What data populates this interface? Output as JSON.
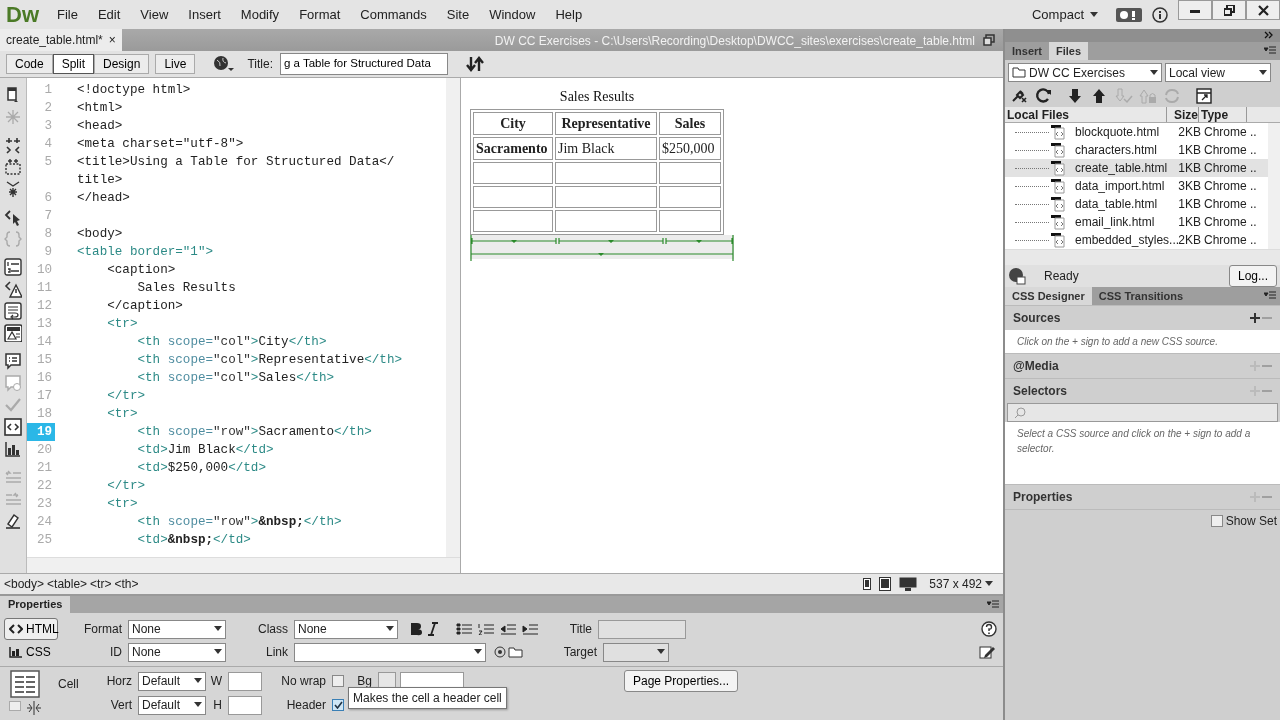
{
  "menu_bar": {
    "logo": "Dw",
    "items": [
      "File",
      "Edit",
      "View",
      "Insert",
      "Modify",
      "Format",
      "Commands",
      "Site",
      "Window",
      "Help"
    ],
    "workspace": "Compact"
  },
  "document_tab": {
    "label": "create_table.html*",
    "close": "×",
    "path": "DW CC Exercises - C:\\Users\\Recording\\Desktop\\DWCC_sites\\exercises\\create_table.html"
  },
  "view_buttons": [
    {
      "label": "Code",
      "selected": false
    },
    {
      "label": "Split",
      "selected": true
    },
    {
      "label": "Design",
      "selected": false
    },
    {
      "label": "Live",
      "selected": false
    }
  ],
  "title_field": {
    "label": "Title:",
    "value": "g a Table for Structured Data"
  },
  "code_lines": [
    {
      "number": "1",
      "current": false,
      "parts": [
        {
          "kind": "text",
          "t": "<!doctype html>"
        }
      ]
    },
    {
      "number": "2",
      "current": false,
      "parts": [
        {
          "kind": "text",
          "t": "<html>"
        }
      ]
    },
    {
      "number": "3",
      "current": false,
      "parts": [
        {
          "kind": "text",
          "t": "<head>"
        }
      ]
    },
    {
      "number": "4",
      "current": false,
      "parts": [
        {
          "kind": "text",
          "t": "<meta charset=\"utf-8\">"
        }
      ]
    },
    {
      "number": "5",
      "current": false,
      "parts": [
        {
          "kind": "text",
          "t": "<title>Using a Table for Structured Data</"
        }
      ]
    },
    {
      "parts": [
        {
          "kind": "text",
          "t": "title>"
        }
      ]
    },
    {
      "number": "6",
      "current": false,
      "parts": [
        {
          "kind": "text",
          "t": "</head>"
        }
      ]
    },
    {
      "number": "7",
      "current": false
    },
    {
      "number": "8",
      "current": false,
      "parts": [
        {
          "kind": "text",
          "t": "<body>"
        }
      ]
    },
    {
      "number": "9",
      "current": false,
      "parts": [
        {
          "kind": "tag",
          "t": "<table border=\"1\">"
        }
      ]
    },
    {
      "number": "10",
      "current": false,
      "parts": [
        {
          "kind": "text",
          "t": "    <caption>"
        }
      ]
    },
    {
      "number": "11",
      "current": false,
      "parts": [
        {
          "kind": "text",
          "t": "        Sales Results"
        }
      ]
    },
    {
      "number": "12",
      "current": false,
      "parts": [
        {
          "kind": "text",
          "t": "    </caption>"
        }
      ]
    },
    {
      "number": "13",
      "current": false,
      "parts": [
        {
          "kind": "tag",
          "t": "    <tr>"
        }
      ]
    },
    {
      "number": "14",
      "current": false,
      "parts": [
        {
          "kind": "tag",
          "t": "        <th "
        },
        {
          "kind": "attr",
          "t": "scope="
        },
        {
          "kind": "value",
          "t": "\"col\""
        },
        {
          "kind": "tag",
          "t": ">"
        },
        {
          "kind": "text",
          "t": "City"
        },
        {
          "kind": "tag",
          "t": "</th>"
        }
      ]
    },
    {
      "number": "15",
      "current": false,
      "parts": [
        {
          "kind": "tag",
          "t": "        <th "
        },
        {
          "kind": "attr",
          "t": "scope="
        },
        {
          "kind": "value",
          "t": "\"col\""
        },
        {
          "kind": "tag",
          "t": ">"
        },
        {
          "kind": "text",
          "t": "Representative"
        },
        {
          "kind": "tag",
          "t": "</th>"
        }
      ]
    },
    {
      "number": "16",
      "current": false,
      "parts": [
        {
          "kind": "tag",
          "t": "        <th "
        },
        {
          "kind": "attr",
          "t": "scope="
        },
        {
          "kind": "value",
          "t": "\"col\""
        },
        {
          "kind": "tag",
          "t": ">"
        },
        {
          "kind": "text",
          "t": "Sales"
        },
        {
          "kind": "tag",
          "t": "</th>"
        }
      ]
    },
    {
      "number": "17",
      "current": false,
      "parts": [
        {
          "kind": "tag",
          "t": "    </tr>"
        }
      ]
    },
    {
      "number": "18",
      "current": false,
      "parts": [
        {
          "kind": "tag",
          "t": "    <tr>"
        }
      ]
    },
    {
      "number": "19",
      "current": true,
      "parts": [
        {
          "kind": "tag",
          "t": "        <th "
        },
        {
          "kind": "attr",
          "t": "scope="
        },
        {
          "kind": "value",
          "t": "\"row\""
        },
        {
          "kind": "tag",
          "t": ">"
        },
        {
          "kind": "text",
          "t": "Sacramento"
        },
        {
          "kind": "tag",
          "t": "</th>"
        }
      ]
    },
    {
      "number": "20",
      "current": false,
      "parts": [
        {
          "kind": "tag",
          "t": "        <td>"
        },
        {
          "kind": "text",
          "t": "Jim Black"
        },
        {
          "kind": "tag",
          "t": "</td>"
        }
      ]
    },
    {
      "number": "21",
      "current": false,
      "parts": [
        {
          "kind": "tag",
          "t": "        <td>"
        },
        {
          "kind": "text",
          "t": "$250,000"
        },
        {
          "kind": "tag",
          "t": "</td>"
        }
      ]
    },
    {
      "number": "22",
      "current": false,
      "parts": [
        {
          "kind": "tag",
          "t": "    </tr>"
        }
      ]
    },
    {
      "number": "23",
      "current": false,
      "parts": [
        {
          "kind": "tag",
          "t": "    <tr>"
        }
      ]
    },
    {
      "number": "24",
      "current": false,
      "parts": [
        {
          "kind": "tag",
          "t": "        <th "
        },
        {
          "kind": "attr",
          "t": "scope="
        },
        {
          "kind": "value",
          "t": "\"row\""
        },
        {
          "kind": "tag",
          "t": ">"
        },
        {
          "kind": "entity",
          "t": "&nbsp;"
        },
        {
          "kind": "tag",
          "t": "</th>"
        }
      ]
    },
    {
      "number": "25",
      "current": false,
      "parts": [
        {
          "kind": "tag",
          "t": "        <td>"
        },
        {
          "kind": "entity",
          "t": "&nbsp;"
        },
        {
          "kind": "tag",
          "t": "</td>"
        }
      ]
    }
  ],
  "design_table": {
    "caption": "Sales Results",
    "columns": [
      "City",
      "Representative",
      "Sales"
    ],
    "rows": [
      {
        "kind": "data",
        "cells": [
          {
            "text": "Sacramento",
            "header": true
          },
          {
            "text": "Jim Black",
            "header": false
          },
          {
            "text": "$250,000",
            "header": false
          }
        ]
      },
      {
        "kind": "blank"
      },
      {
        "kind": "blank"
      },
      {
        "kind": "blank"
      }
    ]
  },
  "tag_selector": [
    "<body>",
    "<table>",
    "<tr>",
    "<th>"
  ],
  "window_size": "537 x 492",
  "properties": {
    "title": "Properties",
    "modes": [
      {
        "label": "HTML",
        "selected": true
      },
      {
        "label": "CSS",
        "selected": false
      }
    ],
    "format": {
      "label": "Format",
      "value": "None"
    },
    "id": {
      "label": "ID",
      "value": "None"
    },
    "class": {
      "label": "Class",
      "value": "None"
    },
    "link": {
      "label": "Link"
    },
    "title_label": "Title",
    "target_label": "Target",
    "cell_label": "Cell",
    "horz": {
      "label": "Horz",
      "value": "Default"
    },
    "vert": {
      "label": "Vert",
      "value": "Default"
    },
    "w_label": "W",
    "h_label": "H",
    "no_wrap": {
      "label": "No wrap",
      "checked": false
    },
    "bg_label": "Bg",
    "header": {
      "label": "Header",
      "checked": true
    },
    "page_properties": "Page Properties...",
    "tooltip": "Makes the cell a header cell"
  },
  "files_panel": {
    "tabs": [
      {
        "label": "Insert",
        "selected": false
      },
      {
        "label": "Files",
        "selected": true
      }
    ],
    "site": "DW CC Exercises",
    "view": "Local view",
    "columns": [
      "Local Files",
      "Size",
      "Type"
    ],
    "files": [
      {
        "name": "blockquote.html",
        "size": "2KB",
        "type": "Chrome ..",
        "selected": false
      },
      {
        "name": "characters.html",
        "size": "1KB",
        "type": "Chrome ..",
        "selected": false
      },
      {
        "name": "create_table.html",
        "size": "1KB",
        "type": "Chrome ..",
        "selected": true
      },
      {
        "name": "data_import.html",
        "size": "3KB",
        "type": "Chrome ..",
        "selected": false
      },
      {
        "name": "data_table.html",
        "size": "1KB",
        "type": "Chrome ..",
        "selected": false
      },
      {
        "name": "email_link.html",
        "size": "1KB",
        "type": "Chrome ..",
        "selected": false
      },
      {
        "name": "embedded_styles...",
        "size": "2KB",
        "type": "Chrome ..",
        "selected": false
      }
    ],
    "status": "Ready",
    "log_button": "Log..."
  },
  "css_panel": {
    "tabs": [
      {
        "label": "CSS Designer",
        "selected": true
      },
      {
        "label": "CSS Transitions",
        "selected": false
      }
    ],
    "sections": [
      {
        "title": "Sources",
        "hint": "Click on the + sign to add a new CSS source.",
        "add_enabled": true
      },
      {
        "title": "@Media",
        "add_enabled": false
      },
      {
        "title": "Selectors",
        "hint": "Select a CSS source and click on the + sign to add a selector.",
        "search": true,
        "add_enabled": false
      },
      {
        "title": "Properties",
        "add_enabled": false
      }
    ],
    "show_set": {
      "label": "Show Set",
      "checked": false
    }
  }
}
